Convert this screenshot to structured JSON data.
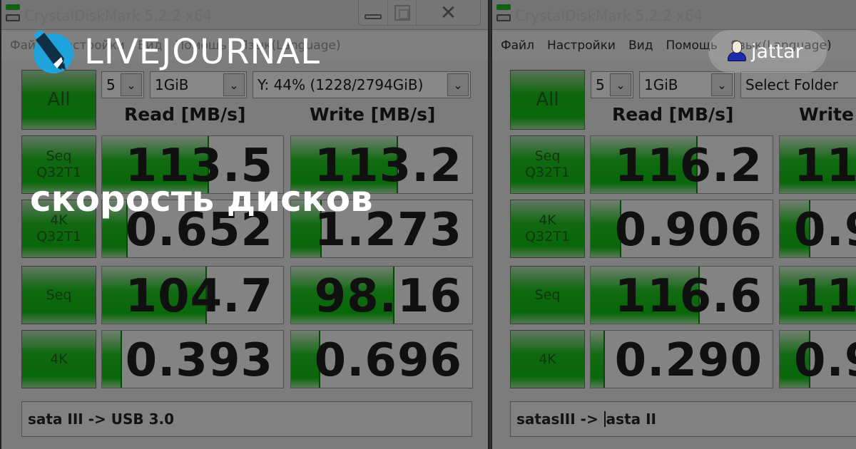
{
  "site": {
    "brand": "LIVEJOURNAL",
    "post_title": "скорость дисков",
    "user": {
      "name": "jattar",
      "icon": "user-icon"
    },
    "colors": {
      "logo_blue": "#1ea3dc",
      "logo_dark": "#0e2f44",
      "overlay_text": "#ffffff",
      "bar_green": "#12b212"
    }
  },
  "windows": [
    {
      "title": "CrystalDiskMark 5.2.2 x64",
      "menu": [
        "Файл",
        "Настройки",
        "Вид",
        "Помощь",
        "Язык(Language)"
      ],
      "controls": {
        "all_label": "All",
        "count": "5",
        "size": "1GiB",
        "drive": "Y: 44% (1228/2794GiB)"
      },
      "headers": {
        "read": "Read [MB/s]",
        "write": "Write [MB/s]"
      },
      "rows": [
        {
          "label_line1": "Seq",
          "label_line2": "Q32T1",
          "read": "113.5",
          "read_fill": 0.59,
          "write": "113.2",
          "write_fill": 0.59
        },
        {
          "label_line1": "4K",
          "label_line2": "Q32T1",
          "read": "0.652",
          "read_fill": 0.14,
          "write": "1.273",
          "write_fill": 0.17
        },
        {
          "label_line1": "Seq",
          "label_line2": "",
          "read": "104.7",
          "read_fill": 0.58,
          "write": "98.16",
          "write_fill": 0.57
        },
        {
          "label_line1": "4K",
          "label_line2": "",
          "read": "0.393",
          "read_fill": 0.11,
          "write": "0.696",
          "write_fill": 0.16
        }
      ],
      "comment": "sata III -> USB 3.0"
    },
    {
      "title": "CrystalDiskMark 5.2.2 x64",
      "menu": [
        "Файл",
        "Настройки",
        "Вид",
        "Помощь",
        "Язык(Language)"
      ],
      "controls": {
        "all_label": "All",
        "count": "5",
        "size": "1GiB",
        "drive": "Select Folder"
      },
      "headers": {
        "read": "Read [MB/s]",
        "write": "Write [MB/s]"
      },
      "rows": [
        {
          "label_line1": "Seq",
          "label_line2": "Q32T1",
          "read": "116.2",
          "read_fill": 0.59,
          "write": "11",
          "write_fill": 0.6
        },
        {
          "label_line1": "4K",
          "label_line2": "Q32T1",
          "read": "0.906",
          "read_fill": 0.17,
          "write": "0.9",
          "write_fill": 0.17
        },
        {
          "label_line1": "Seq",
          "label_line2": "",
          "read": "116.6",
          "read_fill": 0.6,
          "write": "11",
          "write_fill": 0.6
        },
        {
          "label_line1": "4K",
          "label_line2": "",
          "read": "0.290",
          "read_fill": 0.08,
          "write": "0.9",
          "write_fill": 0.17
        }
      ],
      "comment_before_caret": "satasIII -> ",
      "comment_after_caret": "asta II"
    }
  ]
}
